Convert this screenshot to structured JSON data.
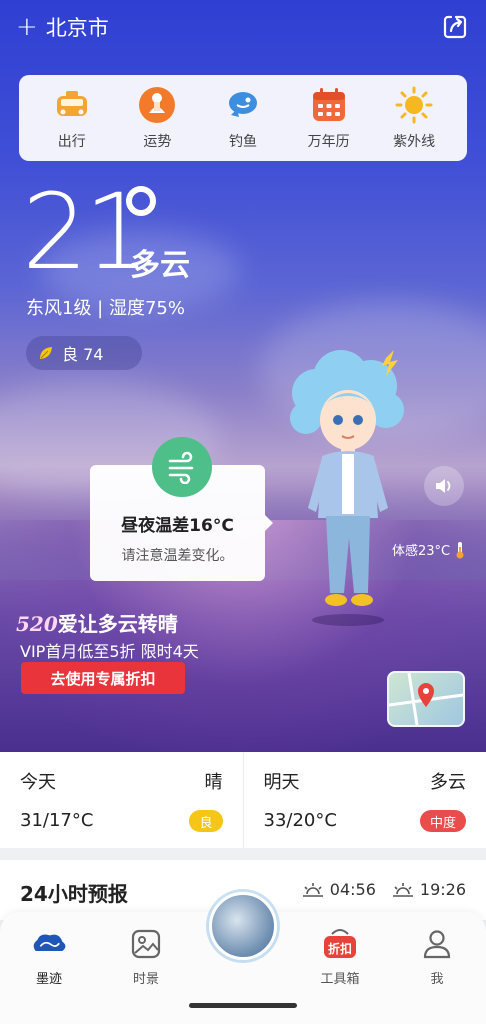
{
  "header": {
    "city": "北京市"
  },
  "quick_actions": [
    {
      "label": "出行",
      "icon": "taxi-icon",
      "color": "#f2a531"
    },
    {
      "label": "运势",
      "icon": "fortune-icon",
      "color": "#f27a2a"
    },
    {
      "label": "钓鱼",
      "icon": "fish-icon",
      "color": "#3e8ee0"
    },
    {
      "label": "万年历",
      "icon": "calendar-icon",
      "color": "#f0693a"
    },
    {
      "label": "紫外线",
      "icon": "sun-icon",
      "color": "#f5b820"
    }
  ],
  "current": {
    "temperature": "21",
    "condition": "多云",
    "wind_humidity": "东风1级 | 湿度75%",
    "aqi": "良 74"
  },
  "tip": {
    "title": "昼夜温差16°C",
    "subtitle": "请注意温差变化。"
  },
  "feels_like": "体感23°C",
  "promo": {
    "number": "520",
    "title": "爱让多云转晴",
    "subtitle": "VIP首月低至5折 限时4天",
    "button": "去使用专属折扣"
  },
  "days": [
    {
      "name": "今天",
      "condition": "晴",
      "temps": "31/17°C",
      "aqi": "良",
      "aqi_color": "#f5c518"
    },
    {
      "name": "明天",
      "condition": "多云",
      "temps": "33/20°C",
      "aqi": "中度",
      "aqi_color": "#ea4b4b"
    }
  ],
  "hourly": {
    "title": "24小时预报",
    "sunrise": "04:56",
    "sunset": "19:26"
  },
  "tabs": [
    {
      "label": "墨迹",
      "icon": "moji-cloud-icon"
    },
    {
      "label": "时景",
      "icon": "photo-icon"
    },
    {
      "label": "工具箱",
      "icon": "toolbox-icon",
      "badge": "折扣"
    },
    {
      "label": "我",
      "icon": "user-icon"
    }
  ]
}
